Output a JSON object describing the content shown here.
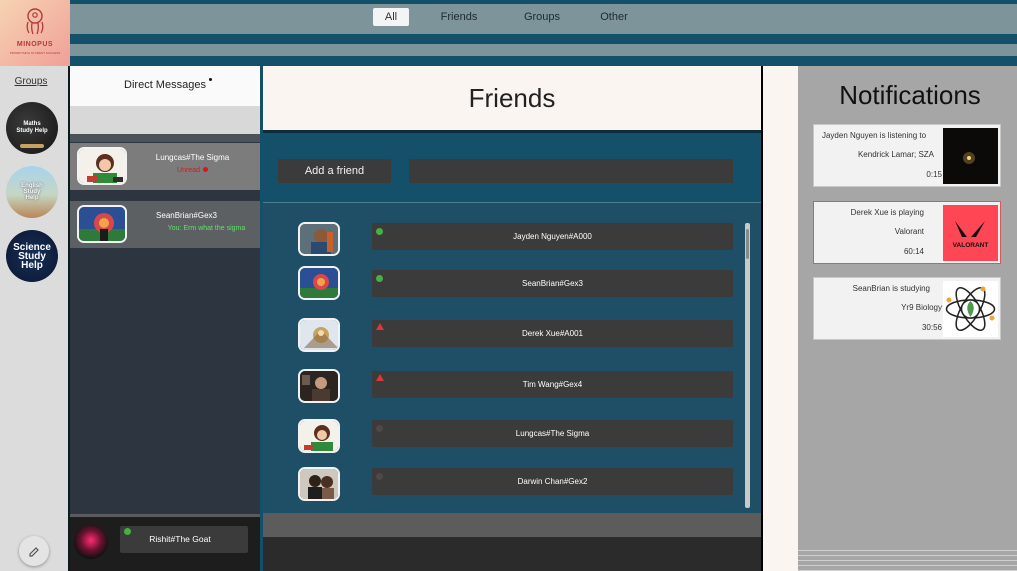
{
  "logo": {
    "name": "MINOPUS",
    "tagline": "PRIORITISING STUDENT SUCCESS"
  },
  "filters": [
    {
      "label": "All",
      "active": true
    },
    {
      "label": "Friends",
      "active": false
    },
    {
      "label": "Groups",
      "active": false
    },
    {
      "label": "Other",
      "active": false
    }
  ],
  "groups": {
    "title": "Groups",
    "items": [
      {
        "label": "Maths Study Help"
      },
      {
        "label": "English Study Help"
      },
      {
        "label": "Science Study Help"
      }
    ]
  },
  "dm": {
    "title": "Direct Messages",
    "conversations": [
      {
        "name": "Lungcas#The Sigma",
        "status": "Unread"
      },
      {
        "name": "SeanBrian#Gex3",
        "preview": "You: Erm what the sigma"
      }
    ],
    "self": {
      "name": "Rishit#The Goat",
      "status": "online"
    }
  },
  "main": {
    "title": "Friends",
    "add_friend_label": "Add a friend",
    "friends": [
      {
        "name": "Jayden Nguyen#A000",
        "status": "online"
      },
      {
        "name": "SeanBrian#Gex3",
        "status": "online"
      },
      {
        "name": "Derek Xue#A001",
        "status": "idle"
      },
      {
        "name": "Tim Wang#Gex4",
        "status": "idle"
      },
      {
        "name": "Lungcas#The Sigma",
        "status": "offline"
      },
      {
        "name": "Darwin Chan#Gex2",
        "status": "offline"
      }
    ]
  },
  "notifications": {
    "title": "Notifications",
    "items": [
      {
        "lines": [
          "Jayden Nguyen is listening to",
          "Kendrick Lamar; SZA",
          "0:15"
        ]
      },
      {
        "lines": [
          "Derek Xue is playing",
          "Valorant",
          "60:14"
        ],
        "logo_text": "VALORANT"
      },
      {
        "lines": [
          "SeanBrian is studying",
          "Yr9 Biology",
          "30:56"
        ]
      }
    ]
  },
  "colors": {
    "accent_teal": "#14506a",
    "online": "#46b045",
    "idle": "#d63a3a",
    "unread": "#e0141b",
    "valorant": "#ff4655"
  }
}
